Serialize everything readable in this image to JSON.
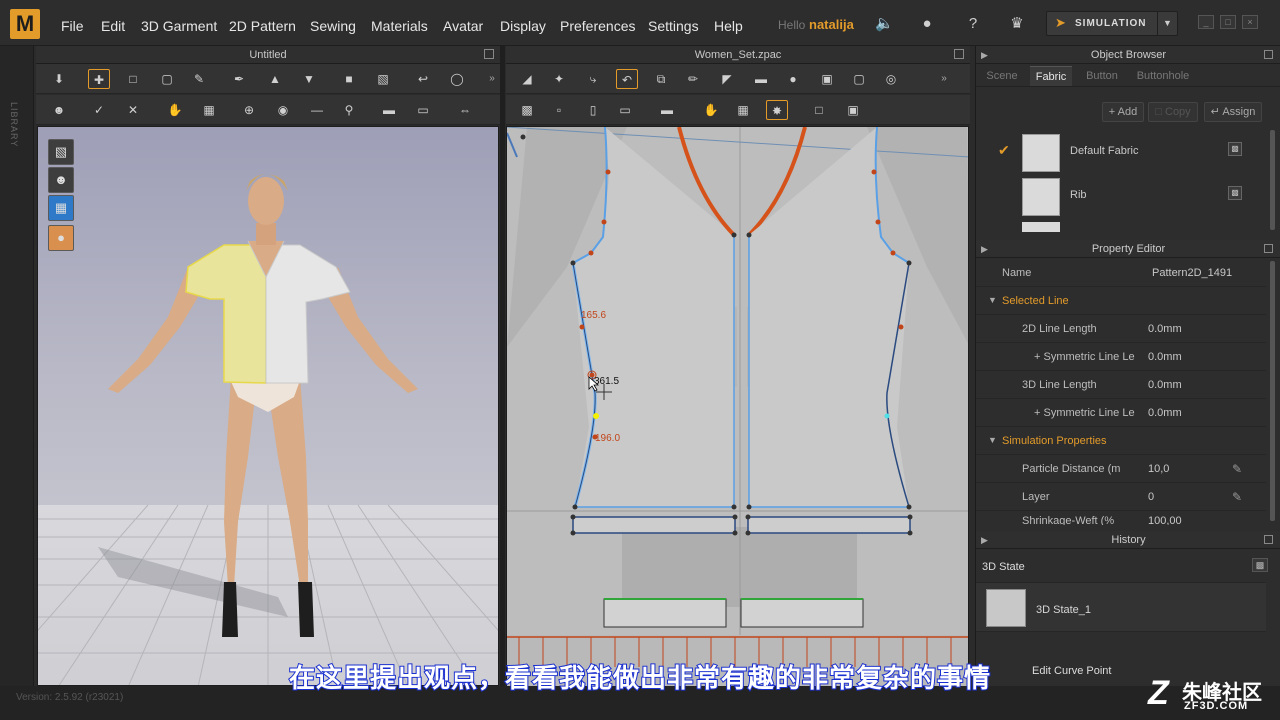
{
  "app": {
    "logo": "M"
  },
  "menu": [
    "File",
    "Edit",
    "3D Garment",
    "2D Pattern",
    "Sewing",
    "Materials",
    "Avatar",
    "Display",
    "Preferences",
    "Settings",
    "Help"
  ],
  "user": {
    "hello": "Hello",
    "name": "natalija"
  },
  "simulation": {
    "label": "SIMULATION"
  },
  "sidebar": {
    "library_label": "LIBRARY"
  },
  "viewport3d": {
    "title": "Untitled"
  },
  "viewport2d": {
    "title": "Women_Set.zpac",
    "measurements": {
      "upper": "165.6",
      "cursor": "361.5",
      "lower": "196.0"
    }
  },
  "object_browser": {
    "title": "Object Browser",
    "tabs": [
      "Scene",
      "Fabric",
      "Button",
      "Buttonhole"
    ],
    "active_tab": "Fabric",
    "buttons": {
      "add": "Add",
      "copy": "Copy",
      "assign": "Assign"
    },
    "fabrics": [
      {
        "name": "Default Fabric",
        "selected": true
      },
      {
        "name": "Rib",
        "selected": false
      }
    ]
  },
  "property_editor": {
    "title": "Property Editor",
    "name_label": "Name",
    "name_value": "Pattern2D_1491",
    "selected_line": {
      "header": "Selected Line",
      "rows": [
        {
          "label": "2D Line Length",
          "value": "0.0mm"
        },
        {
          "label": "+ Symmetric Line Le",
          "value": "0.0mm"
        },
        {
          "label": "3D Line Length",
          "value": "0.0mm"
        },
        {
          "label": "+ Symmetric Line Le",
          "value": "0.0mm"
        }
      ]
    },
    "simulation_properties": {
      "header": "Simulation Properties",
      "rows": [
        {
          "label": "Particle Distance (m",
          "value": "10,0"
        },
        {
          "label": "Layer",
          "value": "0"
        },
        {
          "label": "Shrinkage-Weft (%",
          "value": "100,00"
        }
      ]
    }
  },
  "history": {
    "title": "History",
    "state_label": "3D State",
    "items": [
      {
        "name": "3D State_1"
      }
    ],
    "partial_item": "Edit Curve Point"
  },
  "status": {
    "version": "Version: 2.5.92     (r23021)"
  },
  "subtitle": "在这里提出观点，看看我能做出非常有趣的非常复杂的事情",
  "watermark": {
    "cn": "朱峰社区",
    "en": "ZF3D.COM"
  },
  "colors": {
    "accent": "#e39b2a",
    "line_selected": "#5aa0e6",
    "collar": "#d5531a"
  }
}
